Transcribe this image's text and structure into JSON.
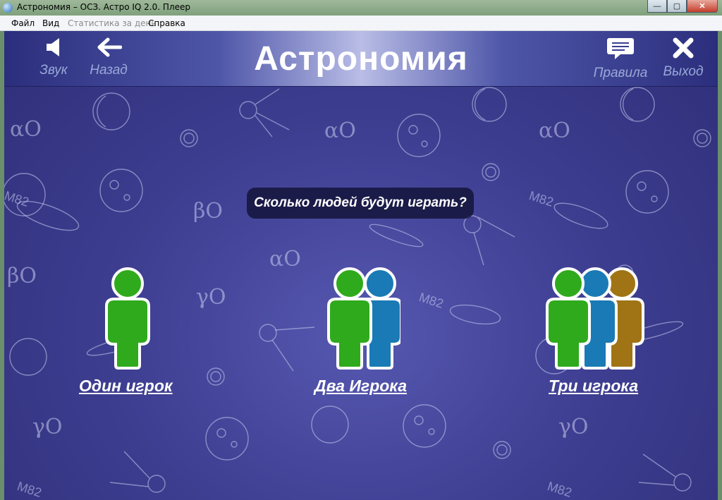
{
  "window": {
    "title": "Астрономия – ОСЗ. Астро IQ 2.0. Плеер",
    "min_symbol": "—",
    "max_symbol": "▢",
    "close_symbol": "✕"
  },
  "menu": {
    "file": "Файл",
    "view": "Вид",
    "stats": "Статистика за день",
    "help": "Справка"
  },
  "header": {
    "title": "Астрономия",
    "sound": "Звук",
    "back": "Назад",
    "rules": "Правила",
    "exit": "Выход"
  },
  "question": "Сколько людей будут играть?",
  "options": [
    {
      "label": "Один игрок",
      "players": 1
    },
    {
      "label": "Два Игрока",
      "players": 2
    },
    {
      "label": "Три игрока",
      "players": 3
    }
  ],
  "colors": {
    "player1": "#2faa1c",
    "player2": "#1a7ab5",
    "player3": "#a07414",
    "background": "#3f3f93",
    "header_label": "#9aa8d8"
  },
  "background_labels": [
    "αO",
    "βO",
    "γO",
    "M82"
  ]
}
